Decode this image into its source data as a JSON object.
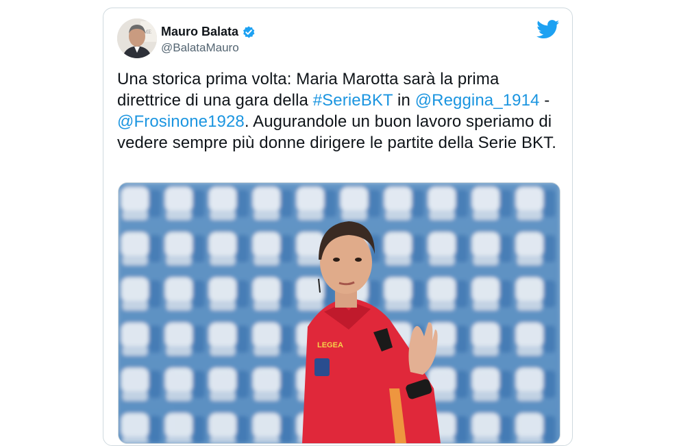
{
  "author": {
    "display_name": "Mauro Balata",
    "handle": "@BalataMauro",
    "verified": true
  },
  "tweet": {
    "text_1": "Una storica prima volta: Maria Marotta sarà la prima direttrice di una gara della ",
    "hashtag": "#SerieBKT",
    "text_2": " in ",
    "mention_1": "@Reggina_1914",
    "text_3": " - ",
    "mention_2": "@Frosinone1928",
    "text_4": ". Augurandole un buon lavoro speriamo di vedere sempre più donne dirigere le partite della Serie BKT."
  },
  "media": {
    "jersey_brand": "LEGEA"
  },
  "colors": {
    "link": "#1b95e0",
    "twitter_blue": "#1da1f2",
    "text": "#0f1419",
    "secondary": "#536471"
  },
  "icons": {
    "verified": "verified-badge-icon",
    "logo": "twitter-bird-icon"
  }
}
